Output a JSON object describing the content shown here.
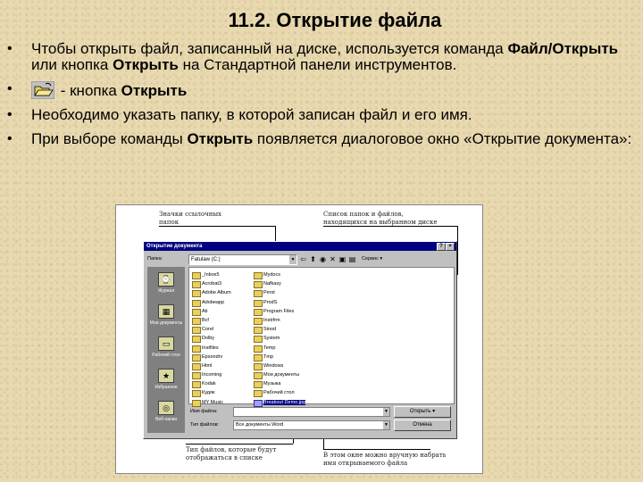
{
  "title": "11.2. Открытие файла",
  "bullets": {
    "b1": {
      "t1": "Чтобы открыть файл, записанный на диске, используется команда ",
      "t2": "Файл/Открыть",
      "t3": " или кнопка ",
      "t4": "Открыть",
      "t5": " на Стандартной панели инструментов."
    },
    "b2": {
      "t1": "- кнопка ",
      "t2": "Открыть"
    },
    "b3": {
      "t1": "Необходимо указать папку, в которой записан файл и его имя."
    },
    "b4": {
      "t1": "При выборе команды  ",
      "t2": "Открыть",
      "t3": " появляется диалоговое окно «Открытие документа»:"
    }
  },
  "bullet_char": "•",
  "annotations": {
    "top_left": "Значки ссылочных папок",
    "top_right": "Список папок и файлов, находящихся на выбранном диске",
    "bottom_left": "Тип файлов, которые будут отображаться в списке",
    "bottom_right": "В этом окне можно вручную набрать имя открываемого файла"
  },
  "dialog": {
    "title": "Открытие документа",
    "btn_help": "?",
    "btn_close": "×",
    "folder_label": "Папка:",
    "folder_value": "Fatulaw (C:)",
    "tools_label": "Сервис ▾",
    "places": [
      "Журнал",
      "Мои документы",
      "Рабочий стол",
      "Избранное",
      "Веб-папки"
    ],
    "files_col1": [
      "_Inbox5",
      "Acrobat3",
      "Adobe Album",
      "Adobeapp",
      "Ati",
      "Bcf",
      "Corel",
      "Dolby",
      "Instfiles",
      "Epsondrv",
      "Html",
      "Incoming",
      "Kodak",
      "Кудяк",
      "MY Music"
    ],
    "files_col2": [
      "Mydocs",
      "Nafkasy",
      "Perst",
      "ProdS",
      "Program Files",
      "Instrfrm",
      "Sinod",
      "System",
      "Temp",
      "Tmp",
      "Windows",
      "Мои документы",
      "Музыка",
      "Рабочий стол",
      "Breakout Demo.jpg"
    ],
    "filename_label": "Имя файла:",
    "filetype_label": "Тип файлов:",
    "filetype_value": "Все документы Word",
    "open_button": "Открыть",
    "cancel_button": "Отмена"
  },
  "colors": {
    "background": "#e8d9b0",
    "titlebar": "#000080",
    "dialog": "#c0c0c0"
  }
}
